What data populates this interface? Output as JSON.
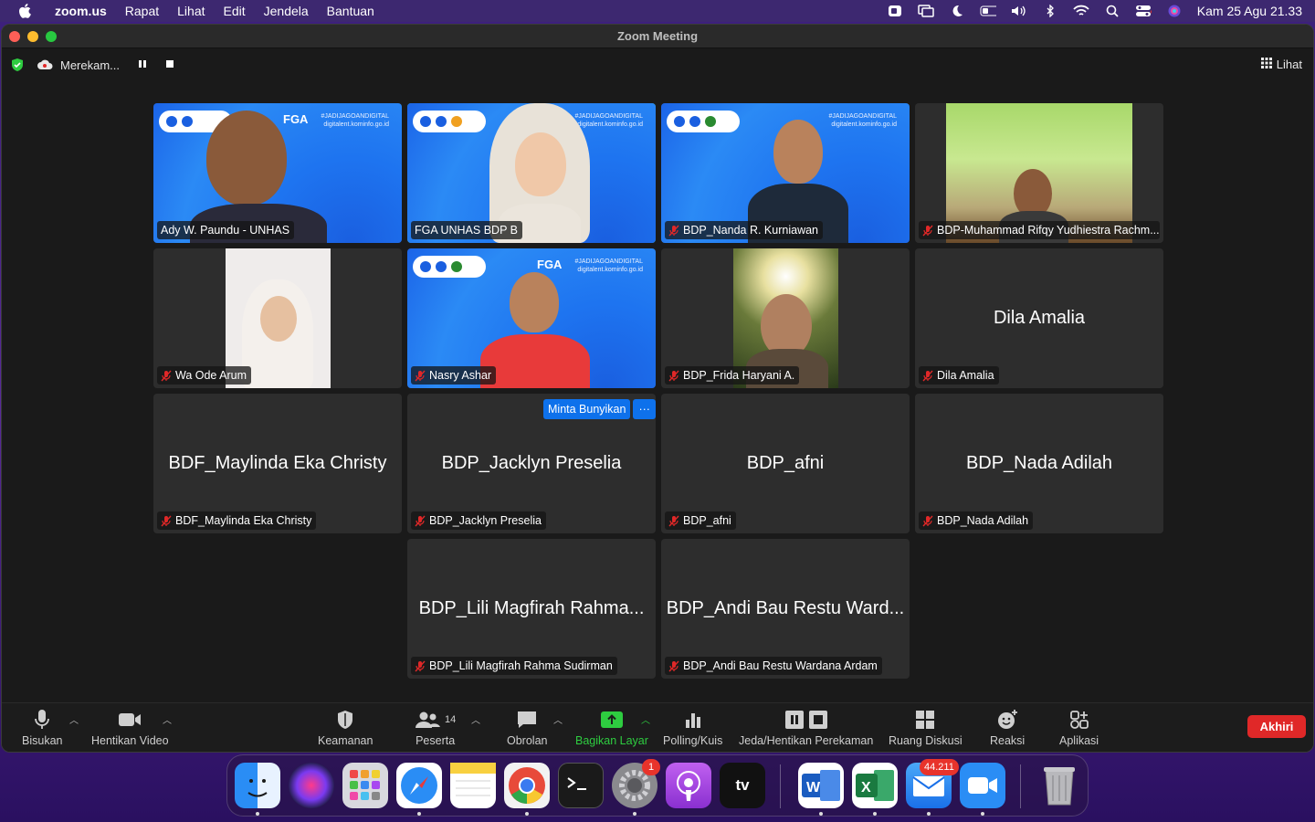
{
  "menubar": {
    "app": "zoom.us",
    "items": [
      "Rapat",
      "Lihat",
      "Edit",
      "Jendela",
      "Bantuan"
    ],
    "datetime": "Kam 25 Agu  21.33"
  },
  "window": {
    "title": "Zoom Meeting",
    "recording_label": "Merekam...",
    "view_label": "Lihat"
  },
  "tiles": [
    {
      "label": "Ady W. Paundu - UNHAS",
      "muted": false,
      "video": true
    },
    {
      "label": "FGA UNHAS BDP B",
      "muted": false,
      "video": true,
      "active": true
    },
    {
      "label": "BDP_Nanda R. Kurniawan",
      "muted": true,
      "video": true
    },
    {
      "label": "BDP-Muhammad Rifqy Yudhiestra Rachm...",
      "muted": true,
      "video": true
    },
    {
      "label": "Wa Ode Arum",
      "muted": true,
      "video": true
    },
    {
      "label": "Nasry Ashar",
      "muted": true,
      "video": true
    },
    {
      "label": "BDP_Frida Haryani A.",
      "muted": true,
      "video": true
    },
    {
      "label": "Dila Amalia",
      "muted": true,
      "video": false,
      "display": "Dila Amalia"
    },
    {
      "label": "BDF_Maylinda Eka Christy",
      "muted": true,
      "video": false,
      "display": "BDF_Maylinda Eka Christy"
    },
    {
      "label": "BDP_Jacklyn Preselia",
      "muted": true,
      "video": false,
      "display": "BDP_Jacklyn Preselia"
    },
    {
      "label": "BDP_afni",
      "muted": true,
      "video": false,
      "display": "BDP_afni"
    },
    {
      "label": "BDP_Nada Adilah",
      "muted": true,
      "video": false,
      "display": "BDP_Nada Adilah"
    },
    {
      "label": "BDP_Lili Magfirah Rahma Sudirman",
      "muted": true,
      "video": false,
      "display": "BDP_Lili Magfirah Rahma..."
    },
    {
      "label": "BDP_Andi Bau Restu Wardana Ardam",
      "muted": true,
      "video": false,
      "display": "BDP_Andi Bau Restu Ward..."
    }
  ],
  "hover_menu": {
    "ask_unmute": "Minta Bunyikan",
    "more": "···"
  },
  "banner": {
    "fga": "FGA",
    "hashtag": "#JADIJAGOANDIGITAL",
    "site": "digitalent.kominfo.go.id"
  },
  "toolbar": {
    "mute": "Bisukan",
    "stop_video": "Hentikan Video",
    "security": "Keamanan",
    "participants": "Peserta",
    "participants_count": "14",
    "chat": "Obrolan",
    "share": "Bagikan Layar",
    "polling": "Polling/Kuis",
    "recording": "Jeda/Hentikan Perekaman",
    "breakout": "Ruang Diskusi",
    "reactions": "Reaksi",
    "apps": "Aplikasi",
    "end": "Akhiri"
  },
  "dock": {
    "apps": [
      "finder",
      "siri",
      "launchpad",
      "safari",
      "notes",
      "chrome",
      "terminal",
      "system-preferences",
      "podcasts",
      "apple-tv",
      "word",
      "excel",
      "mail",
      "zoom",
      "trash"
    ],
    "settings_badge": "1",
    "mail_badge": "44.211",
    "tv_label": "tv"
  },
  "colors": {
    "accent_green": "#2ecc40",
    "end_red": "#e02828",
    "zoom_blue": "#0e71eb"
  }
}
